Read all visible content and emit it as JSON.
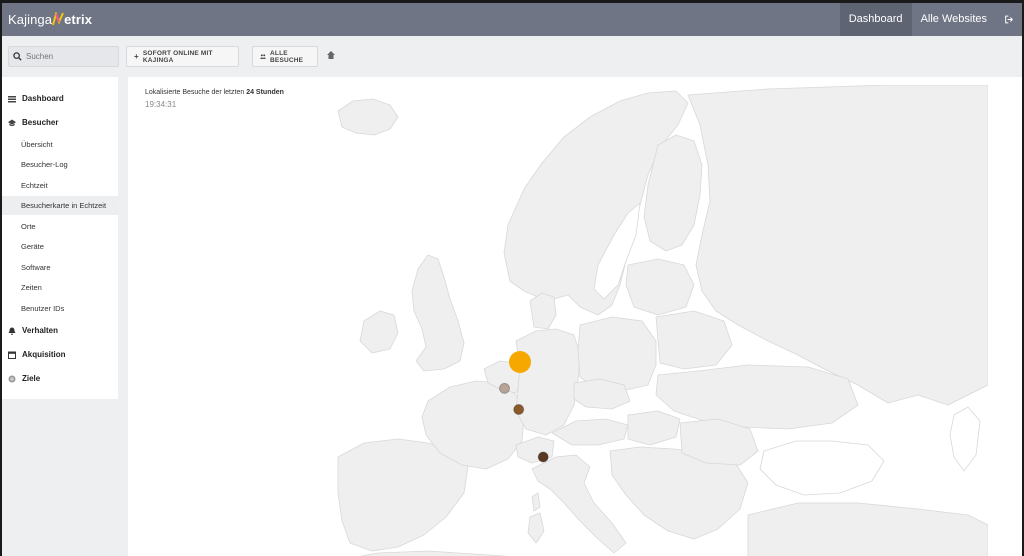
{
  "app": {
    "logo_prefix": "Kajinga",
    "logo_suffix": "etrix"
  },
  "topnav": {
    "items": [
      {
        "label": "Dashboard",
        "active": true
      },
      {
        "label": "Alle Websites",
        "active": false
      }
    ],
    "logout_icon": "logout-icon"
  },
  "toolbar": {
    "search_placeholder": "Suchen",
    "search_icon": "search-icon",
    "sofort_label": "SOFORT ONLINE MIT KAJINGA",
    "sofort_icon": "plus-icon",
    "alle_label": "ALLE BESUCHE",
    "alle_icon": "users-icon",
    "home_icon": "home-icon"
  },
  "sidebar": {
    "items": [
      {
        "label": "Dashboard",
        "type": "section",
        "icon": "dashboard-icon"
      },
      {
        "label": "Besucher",
        "type": "section",
        "icon": "visitors-icon"
      },
      {
        "label": "Übersicht",
        "type": "sub"
      },
      {
        "label": "Besucher-Log",
        "type": "sub"
      },
      {
        "label": "Echtzeit",
        "type": "sub"
      },
      {
        "label": "Besucherkarte in Echtzeit",
        "type": "sub",
        "active": true
      },
      {
        "label": "Orte",
        "type": "sub"
      },
      {
        "label": "Geräte",
        "type": "sub"
      },
      {
        "label": "Software",
        "type": "sub"
      },
      {
        "label": "Zeiten",
        "type": "sub"
      },
      {
        "label": "Benutzer IDs",
        "type": "sub"
      },
      {
        "label": "Verhalten",
        "type": "section",
        "icon": "bell-icon"
      },
      {
        "label": "Akquisition",
        "type": "section",
        "icon": "calendar-icon"
      },
      {
        "label": "Ziele",
        "type": "section",
        "icon": "target-icon"
      }
    ]
  },
  "main": {
    "title_prefix": "Lokalisierte Besuche der letzten",
    "title_bold": "24 Stunden",
    "time": "19:34:31"
  },
  "colors": {
    "topbar": "#6f7584",
    "topbar_active": "#5f6473",
    "map_land": "#efefef",
    "map_border": "#d6d6d6",
    "visit_recent": "#f7a800",
    "visit_mid": "#8a5a2b",
    "visit_old": "#5a3a22",
    "visit_faded": "#b8a497"
  },
  "visits": [
    {
      "lon": 8.7,
      "lat": 52.0,
      "color": "#f7a800",
      "size": "large"
    },
    {
      "lon": 7.5,
      "lat": 50.5,
      "color": "#b8a497",
      "size": "small"
    },
    {
      "lon": 8.6,
      "lat": 49.3,
      "color": "#8a5a2b",
      "size": "small"
    },
    {
      "lon": 10.5,
      "lat": 46.6,
      "color": "#5a3a22",
      "size": "small"
    }
  ]
}
